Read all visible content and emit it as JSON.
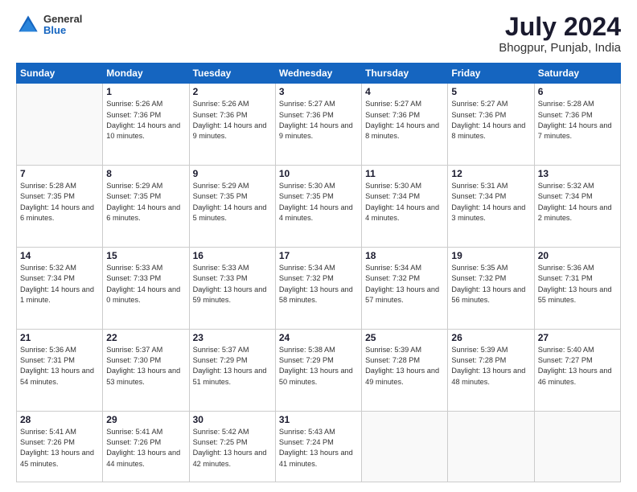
{
  "header": {
    "logo": {
      "general": "General",
      "blue": "Blue"
    },
    "title": "July 2024",
    "location": "Bhogpur, Punjab, India"
  },
  "weekdays": [
    "Sunday",
    "Monday",
    "Tuesday",
    "Wednesday",
    "Thursday",
    "Friday",
    "Saturday"
  ],
  "weeks": [
    [
      {
        "day": "",
        "empty": true
      },
      {
        "day": "1",
        "sunrise": "5:26 AM",
        "sunset": "7:36 PM",
        "daylight": "14 hours and 10 minutes."
      },
      {
        "day": "2",
        "sunrise": "5:26 AM",
        "sunset": "7:36 PM",
        "daylight": "14 hours and 9 minutes."
      },
      {
        "day": "3",
        "sunrise": "5:27 AM",
        "sunset": "7:36 PM",
        "daylight": "14 hours and 9 minutes."
      },
      {
        "day": "4",
        "sunrise": "5:27 AM",
        "sunset": "7:36 PM",
        "daylight": "14 hours and 8 minutes."
      },
      {
        "day": "5",
        "sunrise": "5:27 AM",
        "sunset": "7:36 PM",
        "daylight": "14 hours and 8 minutes."
      },
      {
        "day": "6",
        "sunrise": "5:28 AM",
        "sunset": "7:36 PM",
        "daylight": "14 hours and 7 minutes."
      }
    ],
    [
      {
        "day": "7",
        "sunrise": "5:28 AM",
        "sunset": "7:35 PM",
        "daylight": "14 hours and 6 minutes."
      },
      {
        "day": "8",
        "sunrise": "5:29 AM",
        "sunset": "7:35 PM",
        "daylight": "14 hours and 6 minutes."
      },
      {
        "day": "9",
        "sunrise": "5:29 AM",
        "sunset": "7:35 PM",
        "daylight": "14 hours and 5 minutes."
      },
      {
        "day": "10",
        "sunrise": "5:30 AM",
        "sunset": "7:35 PM",
        "daylight": "14 hours and 4 minutes."
      },
      {
        "day": "11",
        "sunrise": "5:30 AM",
        "sunset": "7:34 PM",
        "daylight": "14 hours and 4 minutes."
      },
      {
        "day": "12",
        "sunrise": "5:31 AM",
        "sunset": "7:34 PM",
        "daylight": "14 hours and 3 minutes."
      },
      {
        "day": "13",
        "sunrise": "5:32 AM",
        "sunset": "7:34 PM",
        "daylight": "14 hours and 2 minutes."
      }
    ],
    [
      {
        "day": "14",
        "sunrise": "5:32 AM",
        "sunset": "7:34 PM",
        "daylight": "14 hours and 1 minute."
      },
      {
        "day": "15",
        "sunrise": "5:33 AM",
        "sunset": "7:33 PM",
        "daylight": "14 hours and 0 minutes."
      },
      {
        "day": "16",
        "sunrise": "5:33 AM",
        "sunset": "7:33 PM",
        "daylight": "13 hours and 59 minutes."
      },
      {
        "day": "17",
        "sunrise": "5:34 AM",
        "sunset": "7:32 PM",
        "daylight": "13 hours and 58 minutes."
      },
      {
        "day": "18",
        "sunrise": "5:34 AM",
        "sunset": "7:32 PM",
        "daylight": "13 hours and 57 minutes."
      },
      {
        "day": "19",
        "sunrise": "5:35 AM",
        "sunset": "7:32 PM",
        "daylight": "13 hours and 56 minutes."
      },
      {
        "day": "20",
        "sunrise": "5:36 AM",
        "sunset": "7:31 PM",
        "daylight": "13 hours and 55 minutes."
      }
    ],
    [
      {
        "day": "21",
        "sunrise": "5:36 AM",
        "sunset": "7:31 PM",
        "daylight": "13 hours and 54 minutes."
      },
      {
        "day": "22",
        "sunrise": "5:37 AM",
        "sunset": "7:30 PM",
        "daylight": "13 hours and 53 minutes."
      },
      {
        "day": "23",
        "sunrise": "5:37 AM",
        "sunset": "7:29 PM",
        "daylight": "13 hours and 51 minutes."
      },
      {
        "day": "24",
        "sunrise": "5:38 AM",
        "sunset": "7:29 PM",
        "daylight": "13 hours and 50 minutes."
      },
      {
        "day": "25",
        "sunrise": "5:39 AM",
        "sunset": "7:28 PM",
        "daylight": "13 hours and 49 minutes."
      },
      {
        "day": "26",
        "sunrise": "5:39 AM",
        "sunset": "7:28 PM",
        "daylight": "13 hours and 48 minutes."
      },
      {
        "day": "27",
        "sunrise": "5:40 AM",
        "sunset": "7:27 PM",
        "daylight": "13 hours and 46 minutes."
      }
    ],
    [
      {
        "day": "28",
        "sunrise": "5:41 AM",
        "sunset": "7:26 PM",
        "daylight": "13 hours and 45 minutes."
      },
      {
        "day": "29",
        "sunrise": "5:41 AM",
        "sunset": "7:26 PM",
        "daylight": "13 hours and 44 minutes."
      },
      {
        "day": "30",
        "sunrise": "5:42 AM",
        "sunset": "7:25 PM",
        "daylight": "13 hours and 42 minutes."
      },
      {
        "day": "31",
        "sunrise": "5:43 AM",
        "sunset": "7:24 PM",
        "daylight": "13 hours and 41 minutes."
      },
      {
        "day": "",
        "empty": true
      },
      {
        "day": "",
        "empty": true
      },
      {
        "day": "",
        "empty": true
      }
    ]
  ]
}
